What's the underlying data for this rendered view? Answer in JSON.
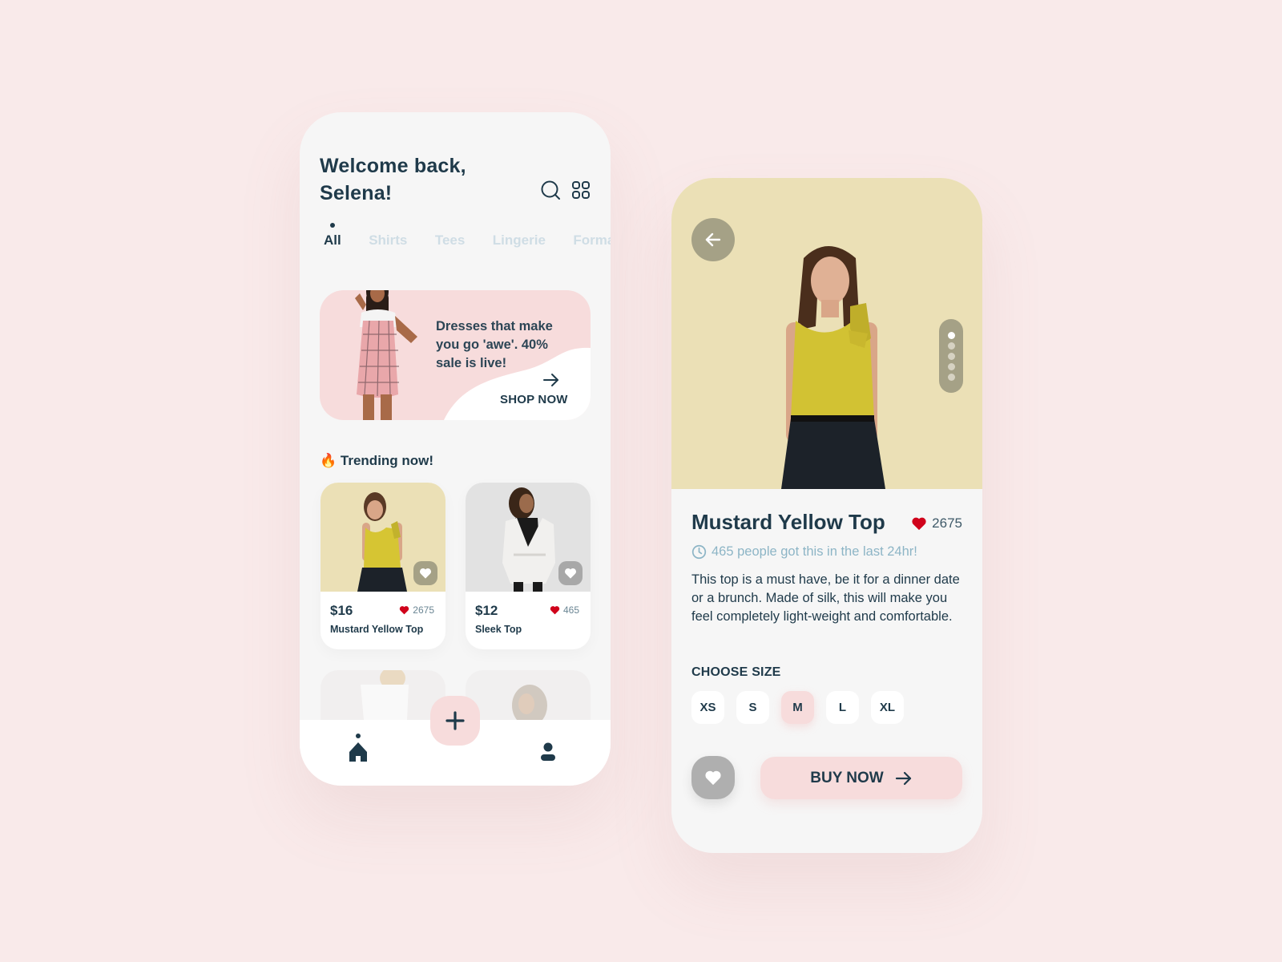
{
  "home": {
    "greeting_line1": "Welcome back,",
    "greeting_line2": "Selena!",
    "icons": {
      "search": "search-icon",
      "grid": "grid-icon"
    },
    "tabs": [
      {
        "label": "All",
        "active": true
      },
      {
        "label": "Shirts",
        "active": false
      },
      {
        "label": "Tees",
        "active": false
      },
      {
        "label": "Lingerie",
        "active": false
      },
      {
        "label": "Formal",
        "active": false
      }
    ],
    "promo": {
      "text": "Dresses that make you go 'awe'. 40% sale is live!",
      "cta": "SHOP NOW"
    },
    "trending_title": "Trending now!",
    "trending_emoji": "🔥",
    "products": [
      {
        "price": "$16",
        "likes": "2675",
        "name": "Mustard Yellow Top",
        "bg": "#ebe0b6"
      },
      {
        "price": "$12",
        "likes": "465",
        "name": "Sleek Top",
        "bg": "#e2e2e2"
      }
    ],
    "nav": {
      "home": "home-icon",
      "add": "plus-icon",
      "profile": "user-icon"
    }
  },
  "detail": {
    "title": "Mustard Yellow Top",
    "likes": "2675",
    "recent": "465 people got this in the last 24hr!",
    "description": "This top is a must have, be it for a dinner date or a brunch. Made of silk, this will make you feel completely light-weight and comfortable.",
    "size_label": "CHOOSE SIZE",
    "sizes": [
      "XS",
      "S",
      "M",
      "L",
      "XL"
    ],
    "selected_size": "M",
    "image_count": 5,
    "active_image": 1,
    "buy_label": "BUY NOW"
  },
  "colors": {
    "background": "#f9eaea",
    "accent_pink": "#f7dcdc",
    "text_dark": "#1f3a4a",
    "heart_red": "#d0021b",
    "muted_blue": "#8db5c6",
    "hero_yellow": "#ebe0b6"
  }
}
